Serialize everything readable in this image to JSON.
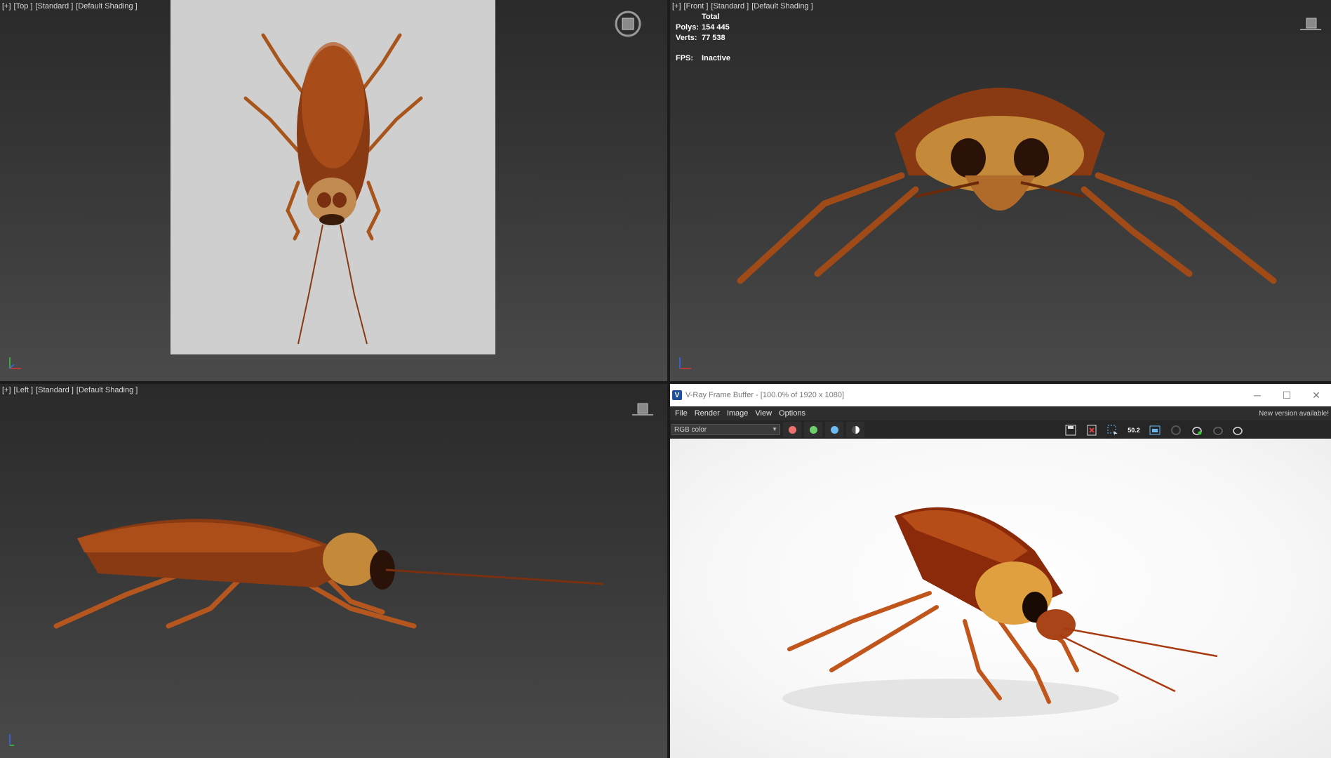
{
  "viewports": {
    "top": {
      "plus": "[+]",
      "view": "[Top ]",
      "shading_mode": "[Standard ]",
      "shading": "[Default Shading ]"
    },
    "front": {
      "plus": "[+]",
      "view": "[Front ]",
      "shading_mode": "[Standard ]",
      "shading": "[Default Shading ]"
    },
    "left": {
      "plus": "[+]",
      "view": "[Left ]",
      "shading_mode": "[Standard ]",
      "shading": "[Default Shading ]"
    }
  },
  "stats": {
    "total_label": "Total",
    "polys_label": "Polys:",
    "polys_value": "154 445",
    "verts_label": "Verts:",
    "verts_value": "77 538",
    "fps_label": "FPS:",
    "fps_value": "Inactive"
  },
  "vfb": {
    "title": "V-Ray Frame Buffer - [100.0% of 1920 x 1080]",
    "menu": [
      "File",
      "Render",
      "Image",
      "View",
      "Options"
    ],
    "notice": "New version available!",
    "channel": "RGB color",
    "zoom_value": "50.2",
    "window_controls": {
      "minimize": "─",
      "maximize": "☐",
      "close": "✕"
    }
  },
  "icons": [
    "viewcube-icon",
    "axis-tripod-icon",
    "save-icon",
    "clear-icon",
    "region-icon",
    "lut-icon",
    "render-icon",
    "teapot-icon"
  ],
  "colors": {
    "red_channel": "#f07070",
    "green_channel": "#6ccf6c",
    "blue_channel": "#6cb8f0",
    "body": "#8a3a12",
    "leg": "#b5561e"
  }
}
